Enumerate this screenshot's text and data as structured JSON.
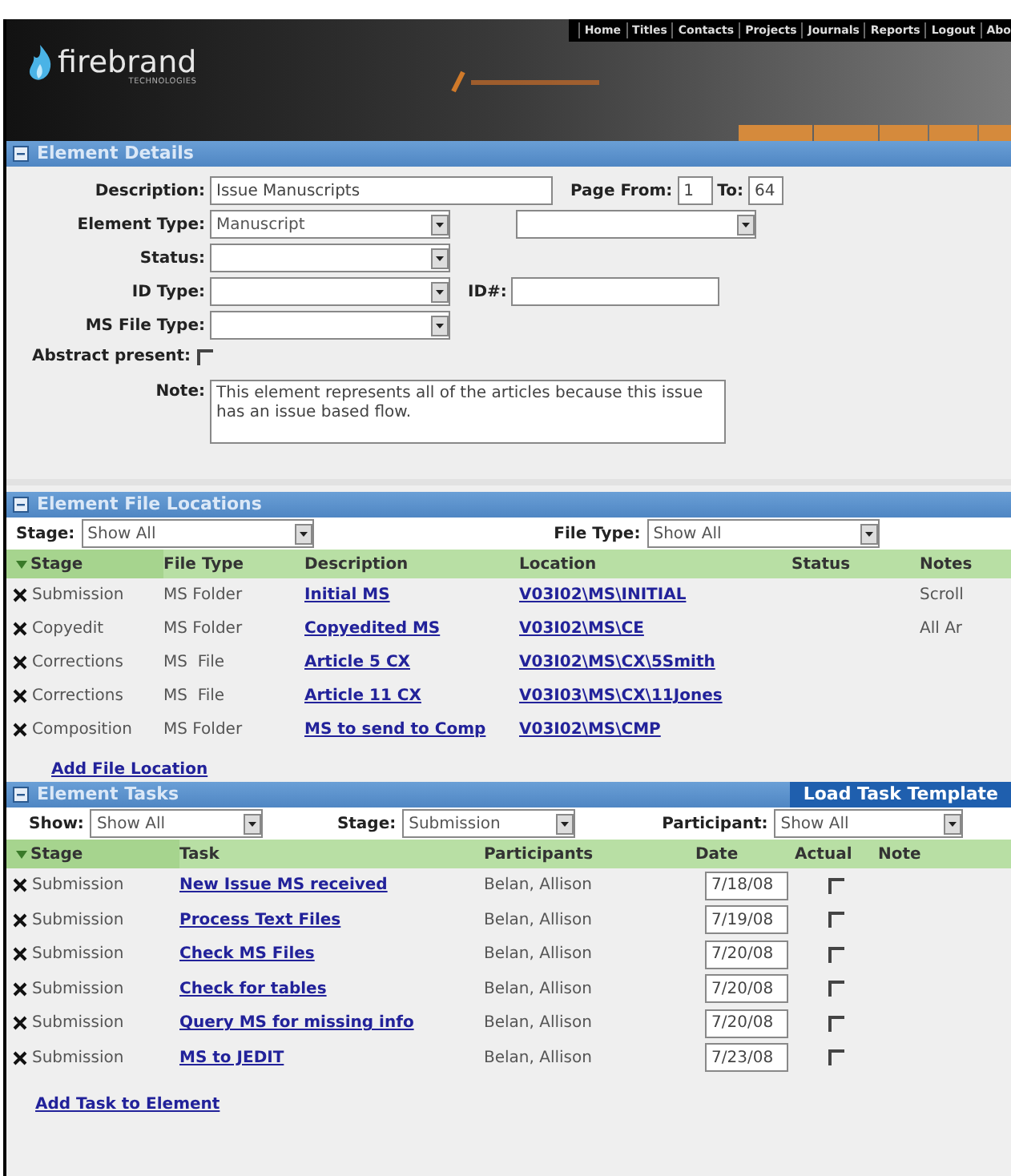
{
  "header": {
    "brand": "firebrand",
    "brand_sub": "TECHNOLOGIES",
    "nav_links": [
      "Home",
      "Titles",
      "Contacts",
      "Projects",
      "Journals",
      "Reports",
      "Logout",
      "Abo"
    ]
  },
  "element_details": {
    "title": "Element Details",
    "description_label": "Description:",
    "description": "Issue Manuscripts",
    "page_from_label": "Page From:",
    "page_from": "1",
    "page_to_label": "To:",
    "page_to": "64",
    "element_type_label": "Element Type:",
    "element_type": "Manuscript",
    "status_label": "Status:",
    "id_type_label": "ID Type:",
    "id_number_label": "ID#:",
    "ms_file_type_label": "MS File Type:",
    "abstract_label": "Abstract present:",
    "abstract_present": false,
    "note_label": "Note:",
    "note": "This element represents all of the articles because this issue has an issue based flow."
  },
  "file_locations": {
    "title": "Element File Locations",
    "stage_label": "Stage:",
    "stage_filter": "Show All",
    "file_type_label": "File Type:",
    "file_type_filter": "Show All",
    "columns": [
      "Stage",
      "File Type",
      "Description",
      "Location",
      "Status",
      "Notes"
    ],
    "rows": [
      {
        "stage": "Submission",
        "file_type": "MS Folder",
        "description": "Initial MS",
        "location": "V03I02\\MS\\INITIAL",
        "notes": "Scroll"
      },
      {
        "stage": "Copyedit",
        "file_type": "MS Folder",
        "description": "Copyedited MS",
        "location": "V03I02\\MS\\CE",
        "notes": "All Ar"
      },
      {
        "stage": "Corrections",
        "file_type": "MS  File",
        "description": "Article 5 CX",
        "location": "V03I02\\MS\\CX\\5Smith"
      },
      {
        "stage": "Corrections",
        "file_type": "MS  File",
        "description": "Article 11 CX",
        "location": "V03I03\\MS\\CX\\11Jones"
      },
      {
        "stage": "Composition",
        "file_type": "MS Folder",
        "description": "MS to send to Comp",
        "location": "V03I02\\MS\\CMP"
      }
    ],
    "add_link": "Add File Location"
  },
  "tasks": {
    "title": "Element Tasks",
    "load_button": "Load Task Template",
    "show_label": "Show:",
    "show_filter": "Show All",
    "stage_label": "Stage:",
    "stage_filter": "Submission",
    "participant_label": "Participant:",
    "participant_filter": "Show All",
    "columns": [
      "Stage",
      "Task",
      "Participants",
      "Date",
      "Actual",
      "Note"
    ],
    "rows": [
      {
        "stage": "Submission",
        "task": "New Issue MS received",
        "participant": "Belan, Allison",
        "date": "7/18/08",
        "actual": false
      },
      {
        "stage": "Submission",
        "task": "Process Text Files",
        "participant": "Belan, Allison",
        "date": "7/19/08",
        "actual": false
      },
      {
        "stage": "Submission",
        "task": "Check MS Files",
        "participant": "Belan, Allison",
        "date": "7/20/08",
        "actual": false
      },
      {
        "stage": "Submission",
        "task": "Check for tables",
        "participant": "Belan, Allison",
        "date": "7/20/08",
        "actual": false
      },
      {
        "stage": "Submission",
        "task": "Query MS for missing info",
        "participant": "Belan, Allison",
        "date": "7/20/08",
        "actual": false
      },
      {
        "stage": "Submission",
        "task": "MS to JEDIT",
        "participant": "Belan, Allison",
        "date": "7/23/08",
        "actual": false
      }
    ],
    "add_link": "Add Task to Element"
  }
}
